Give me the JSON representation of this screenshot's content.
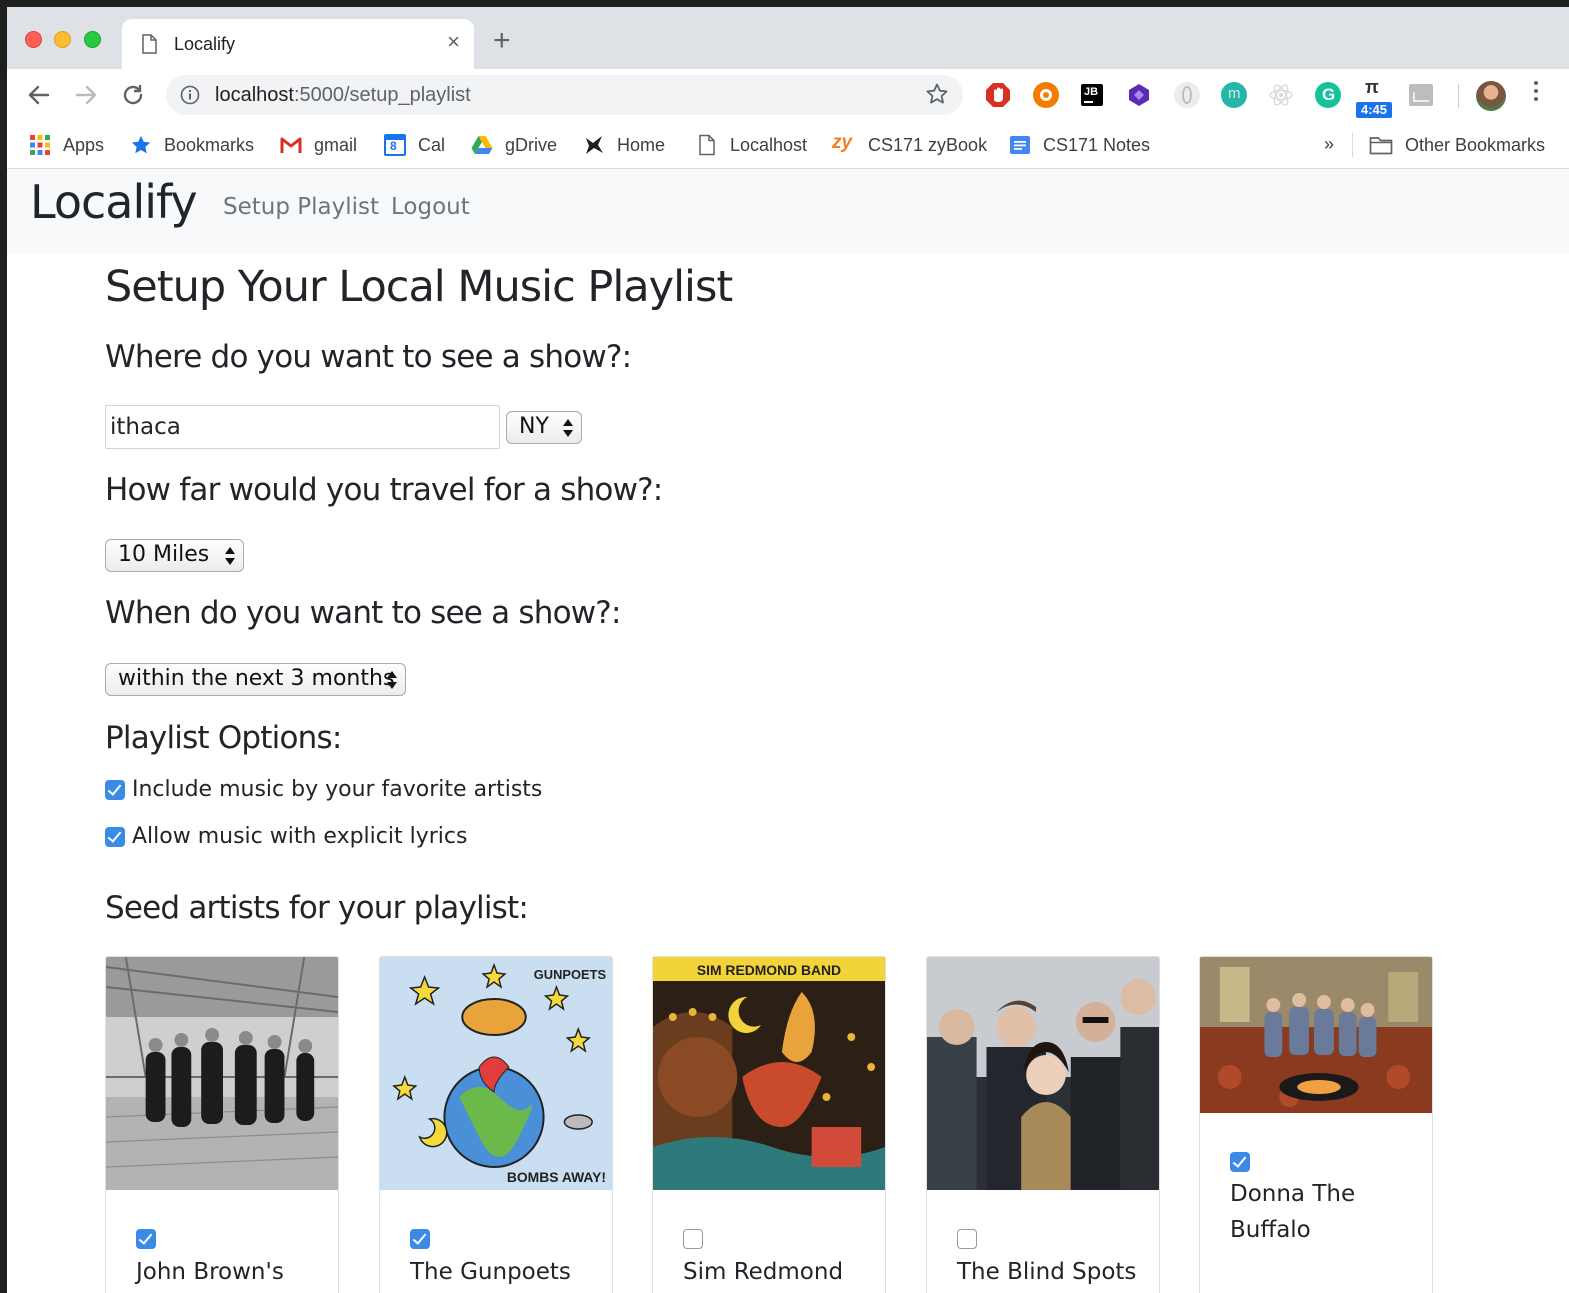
{
  "browser": {
    "tab_title": "Localify",
    "tab_close": "×",
    "new_tab": "+",
    "url_host": "localhost",
    "url_path": ":5000/setup_playlist",
    "ext_badge": "4:45",
    "ext_pi": "π",
    "bookmarks_more": "»",
    "bookmarks": [
      {
        "label": "Apps"
      },
      {
        "label": "Bookmarks"
      },
      {
        "label": "gmail"
      },
      {
        "label": "Cal"
      },
      {
        "label": "gDrive"
      },
      {
        "label": "Home"
      },
      {
        "label": "Localhost"
      },
      {
        "label": "CS171 zyBook"
      },
      {
        "label": "CS171 Notes"
      },
      {
        "label": "Other Bookmarks"
      }
    ],
    "cal_number": "8",
    "zy_text": "zy"
  },
  "nav": {
    "brand": "Localify",
    "links": [
      "Setup Playlist",
      "Logout"
    ]
  },
  "page": {
    "title": "Setup Your Local Music Playlist",
    "q_where": "Where do you want to see a show?:",
    "city_value": "ithaca",
    "state_value": "NY",
    "q_far": "How far would you travel for a show?:",
    "distance_value": "10 Miles",
    "q_when": "When do you want to see a show?:",
    "when_value": "within the next 3 months",
    "options_heading": "Playlist Options:",
    "options": [
      {
        "label": "Include music by your favorite artists",
        "checked": true
      },
      {
        "label": "Allow music with explicit lyrics",
        "checked": true
      }
    ],
    "seed_heading": "Seed artists for your playlist:",
    "artists": [
      {
        "name": "John Brown's",
        "checked": true
      },
      {
        "name": "The Gunpoets",
        "checked": true,
        "cover_text_top": "GUNPOETS",
        "cover_text_bottom": "BOMBS AWAY!"
      },
      {
        "name": "Sim Redmond",
        "checked": false,
        "cover_text_top": "SIM REDMOND BAND"
      },
      {
        "name": "The Blind Spots",
        "checked": false
      },
      {
        "name": "Donna The Buffalo",
        "checked": true
      }
    ]
  },
  "colors": {
    "accent_checkbox": "#3b8be6",
    "navbar_bg": "#f8f9fa",
    "tabstrip_bg": "#dee1e6"
  }
}
